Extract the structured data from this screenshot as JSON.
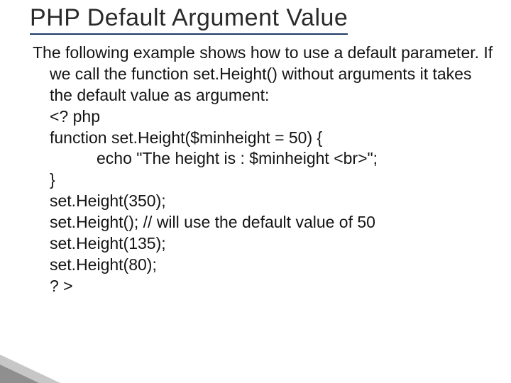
{
  "title": "PHP Default Argument Value",
  "intro": "The following example shows how to use a default parameter. If we call the function set.Height() without arguments it takes the default value as argument:",
  "code": {
    "l1": "<? php",
    "l2": "function set.Height($minheight = 50) {",
    "l3": "echo \"The height is : $minheight <br>\";",
    "l4": "}",
    "l5": "set.Height(350);",
    "l6": "set.Height(); // will use the default value of 50",
    "l7": "set.Height(135);",
    "l8": "set.Height(80);",
    "l9": "? >"
  }
}
